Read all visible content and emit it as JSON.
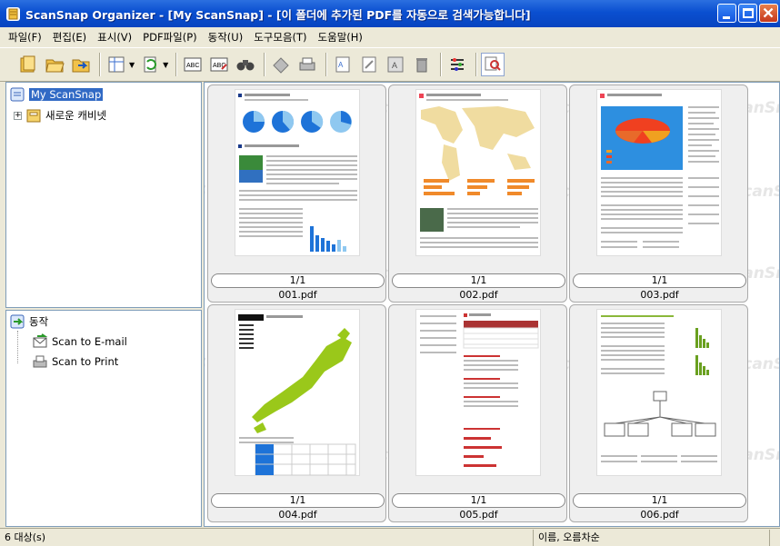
{
  "window": {
    "title": "ScanSnap Organizer - [My ScanSnap] - [이 폴더에 추가된 PDF를 자동으로 검색가능합니다]"
  },
  "menu": [
    "파일(F)",
    "편집(E)",
    "표시(V)",
    "PDF파일(P)",
    "동작(U)",
    "도구모음(T)",
    "도움말(H)"
  ],
  "toolbar": {
    "icons": [
      "new-folder-icon",
      "open-folder-icon",
      "move-folder-icon",
      "view-icon",
      "rotate-icon",
      "text-recognition-icon",
      "keyword-icon",
      "search-icon",
      "scan-icon",
      "print-icon",
      "thumbnail-icon",
      "edit-icon",
      "page-icon",
      "delete-icon",
      "settings-icon",
      "zoom-icon"
    ]
  },
  "tree": {
    "root": "My ScanSnap",
    "cabinet": "새로운 캐비넷",
    "expander": "+"
  },
  "actions": {
    "header": "동작",
    "items": [
      "Scan to E-mail",
      "Scan to Print"
    ]
  },
  "watermark": "ScanSnap",
  "files": [
    {
      "name": "001.pdf",
      "pages": "1/1"
    },
    {
      "name": "002.pdf",
      "pages": "1/1"
    },
    {
      "name": "003.pdf",
      "pages": "1/1"
    },
    {
      "name": "004.pdf",
      "pages": "1/1"
    },
    {
      "name": "005.pdf",
      "pages": "1/1"
    },
    {
      "name": "006.pdf",
      "pages": "1/1"
    }
  ],
  "status": {
    "count": "6 대상(s)",
    "sort": "이름, 오름차순"
  }
}
